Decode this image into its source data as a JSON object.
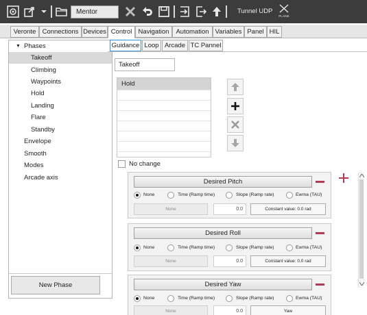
{
  "toolbar": {
    "mentor_label": "Mentor",
    "tunnel_label": "Tunnel UDP",
    "plane_label": "PLANE",
    "colors": {
      "background": "#3c3c3c",
      "icon": "#e6e6e6"
    },
    "icons": [
      "gear-icon",
      "export-icon",
      "dropdown-arrow-icon",
      "folder-icon",
      "close-icon",
      "undo-icon",
      "save-icon",
      "import-icon",
      "export-file-icon",
      "upload-arrow-icon",
      "plane-icon"
    ]
  },
  "main_tabs": [
    "Veronte",
    "Connections",
    "Devices",
    "Control",
    "Navigation",
    "Automation",
    "Variables",
    "Panel",
    "HIL"
  ],
  "active_main_tab": "Control",
  "tree": {
    "phases_label": "Phases",
    "phases": [
      "Takeoff",
      "Climbing",
      "Waypoints",
      "Hold",
      "Landing",
      "Flare",
      "Standby"
    ],
    "selected": "Takeoff",
    "others": [
      "Envelope",
      "Smooth",
      "Modes",
      "Arcade axis"
    ]
  },
  "new_phase_label": "New Phase",
  "sub_tabs": [
    "Guidance",
    "Loop",
    "Arcade",
    "TC Pannel"
  ],
  "active_sub_tab": "Guidance",
  "guidance": {
    "phase_name": "Takeoff",
    "list_items": [
      "Hold"
    ],
    "no_change_label": "No change"
  },
  "radio_labels": [
    "None",
    "Time (Ramp time)",
    "Slope (Ramp rate)",
    "Ewma (TAU)"
  ],
  "desired": [
    {
      "title": "Desired Pitch",
      "selected": "None",
      "field_placeholder": "None",
      "value": "0.0",
      "button": "Constant value: 0.0 rad"
    },
    {
      "title": "Desired Roll",
      "selected": "None",
      "field_placeholder": "None",
      "value": "0.0",
      "button": "Constant value: 0.0 rad"
    },
    {
      "title": "Desired Yaw",
      "selected": "None",
      "field_placeholder": "None",
      "value": "0.0",
      "button": "Yaw"
    }
  ],
  "accent_colors": {
    "minus": "#b23a54",
    "active_subtab_border": "#3b8fd6"
  }
}
